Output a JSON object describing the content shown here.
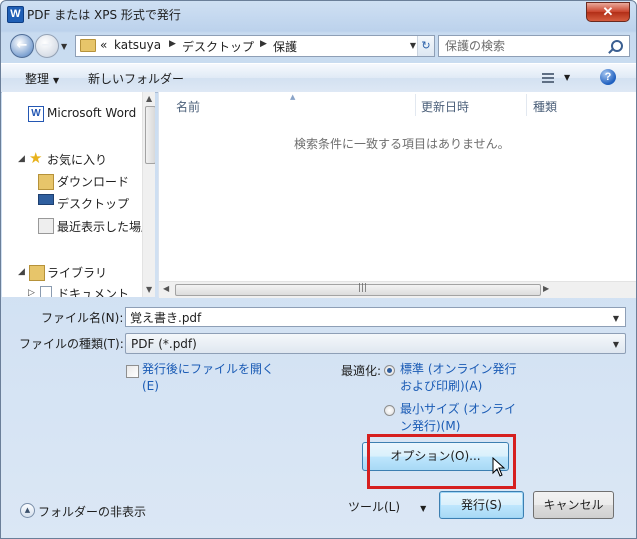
{
  "window": {
    "title": "PDF または XPS 形式で発行",
    "app_icon": "W",
    "close_glyph": "✕"
  },
  "address_bar": {
    "overflow": "«",
    "crumbs": [
      "katsuya",
      "デスクトップ",
      "保護"
    ],
    "search_placeholder": "保護の検索"
  },
  "toolbar": {
    "organize": "整理",
    "new_folder": "新しいフォルダー"
  },
  "nav": {
    "items": [
      {
        "label": "Microsoft Word",
        "icon": "word-icon"
      },
      {
        "label": "お気に入り",
        "icon": "star-icon"
      },
      {
        "label": "ダウンロード",
        "icon": "download-folder-icon"
      },
      {
        "label": "デスクトップ",
        "icon": "desktop-icon"
      },
      {
        "label": "最近表示した場所",
        "icon": "recent-places-icon"
      },
      {
        "label": "ライブラリ",
        "icon": "library-icon"
      },
      {
        "label": "ドキュメント",
        "icon": "documents-icon"
      }
    ]
  },
  "files": {
    "columns": [
      "名前",
      "更新日時",
      "種類"
    ],
    "empty_message": "検索条件に一致する項目はありません。"
  },
  "form": {
    "filename_label": "ファイル名(N):",
    "filename_value": "覚え書き.pdf",
    "filetype_label": "ファイルの種類(T):",
    "filetype_value": "PDF (*.pdf)",
    "open_after_label_1": "発行後にファイルを開く",
    "open_after_label_2": "(E)",
    "open_after_checked": false,
    "optimize_label": "最適化:",
    "opt_standard_1": "標準 (オンライン発行",
    "opt_standard_2": "および印刷)(A)",
    "opt_minimum_1": "最小サイズ (オンライ",
    "opt_minimum_2": "ン発行)(M)",
    "selected_optimization": "standard"
  },
  "buttons": {
    "options": "オプション(O)...",
    "tools": "ツール(L)",
    "publish": "発行(S)",
    "cancel": "キャンセル",
    "hide_folders": "フォルダーの非表示"
  },
  "colors": {
    "highlight": "#d61f1f",
    "link": "#1a5bb5"
  }
}
